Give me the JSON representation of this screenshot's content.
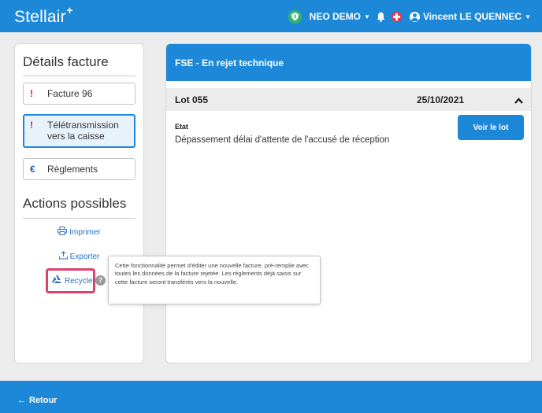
{
  "header": {
    "brand": "Stellair",
    "brand_mark": "+",
    "org_name": "NEO DEMO",
    "user_name": "Vincent LE QUENNEC"
  },
  "left": {
    "details_title": "Détails facture",
    "nav": [
      {
        "mark": "!",
        "label": "Facture 96",
        "icon": "alert-icon"
      },
      {
        "mark": "!",
        "label": "Télétransmission vers la caisse",
        "icon": "alert-icon"
      },
      {
        "mark": "€",
        "label": "Règlements",
        "icon": "euro-icon"
      }
    ],
    "actions_title": "Actions possibles",
    "actions": {
      "print": "Imprimer",
      "export": "Exporter",
      "recycle": "Recycler"
    },
    "help_mark": "?"
  },
  "tooltip": {
    "text": "Cette fonctionnalité permet d'éditer une nouvelle facture, pré-remplie avec toutes les données de la facture rejetée. Les règlements déjà saisis sur cette facture seront transférés vers la nouvelle."
  },
  "right": {
    "panel_title": "FSE - En rejet technique",
    "lot_name": "Lot 055",
    "lot_date": "25/10/2021",
    "etat_label": "Etat",
    "etat_value": "Dépassement délai d'attente de l'accusé de réception",
    "voir_lot_label": "Voir le lot"
  },
  "footer": {
    "back_label": "Retour"
  },
  "colors": {
    "primary": "#1e88d8",
    "alert": "#d0202f",
    "highlight": "#d9436d",
    "link": "#2a72c4"
  }
}
